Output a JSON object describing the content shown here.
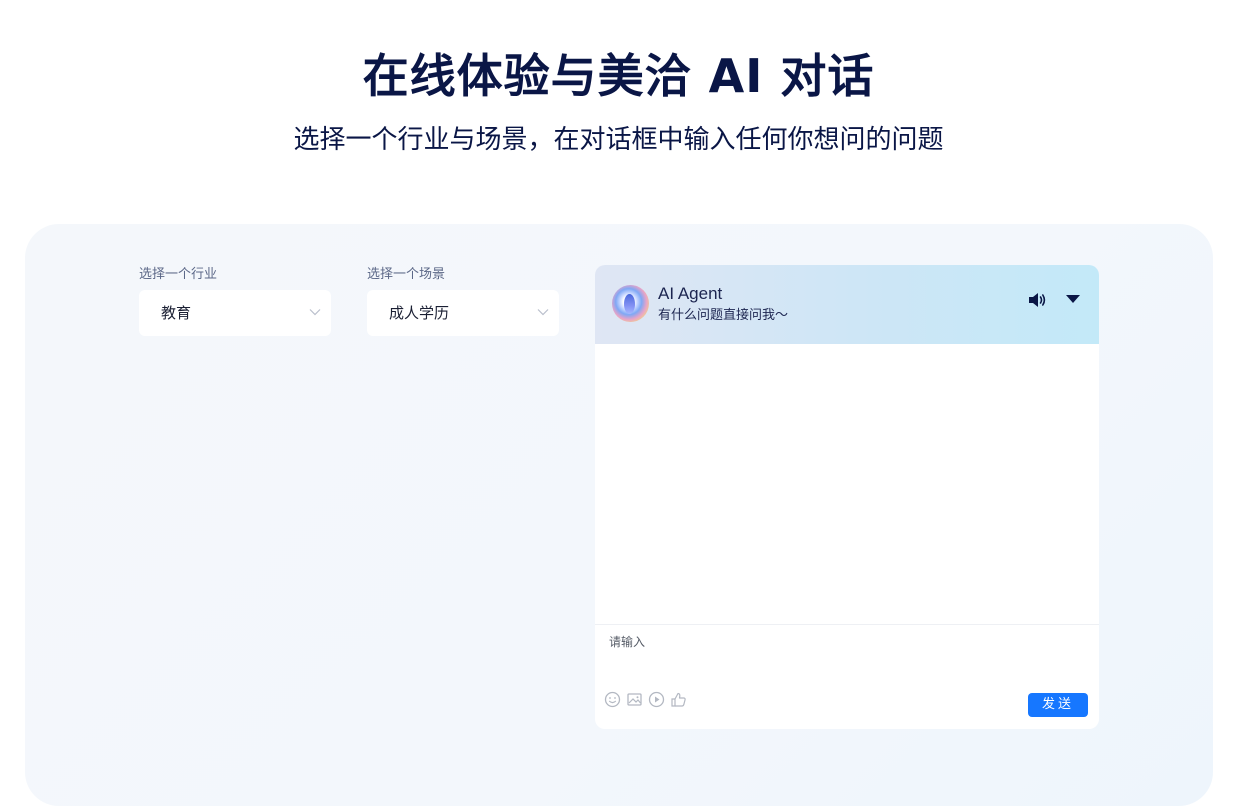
{
  "hero": {
    "title": "在线体验与美洽 AI 对话",
    "subtitle": "选择一个行业与场景，在对话框中输入任何你想问的问题"
  },
  "industry_select": {
    "label": "选择一个行业",
    "value": "教育"
  },
  "scenario_select": {
    "label": "选择一个场景",
    "value": "成人学历"
  },
  "chat": {
    "agent_name": "AI Agent",
    "agent_subtitle": "有什么问题直接问我～",
    "input_placeholder": "请输入",
    "send_label": "发送",
    "toolbar_icons": [
      "emoji-icon",
      "image-icon",
      "video-icon",
      "thumbs-up-icon"
    ]
  },
  "colors": {
    "title": "#0a1646",
    "send_button": "#1677ff",
    "panel_background": "#f4f7fb"
  }
}
